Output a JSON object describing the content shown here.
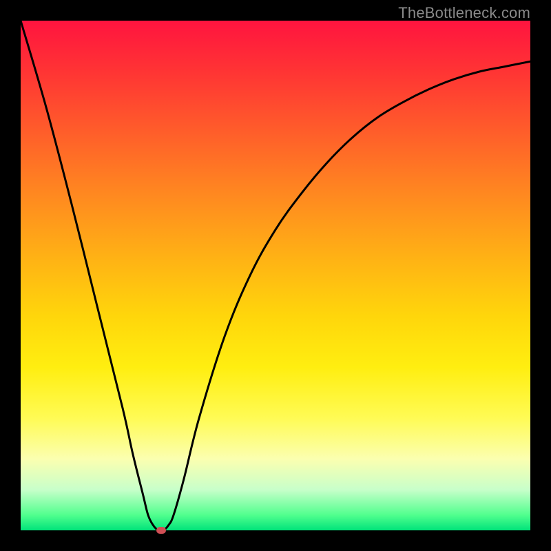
{
  "watermark": "TheBottleneck.com",
  "chart_data": {
    "type": "line",
    "title": "",
    "xlabel": "",
    "ylabel": "",
    "xlim": [
      0,
      100
    ],
    "ylim": [
      0,
      100
    ],
    "grid": false,
    "legend": false,
    "series": [
      {
        "name": "curve",
        "x": [
          0,
          5,
          10,
          15,
          20,
          22,
          24,
          25,
          26,
          27,
          28,
          29,
          30,
          32,
          35,
          40,
          45,
          50,
          55,
          60,
          65,
          70,
          75,
          80,
          85,
          90,
          95,
          100
        ],
        "values": [
          100,
          83,
          64,
          44,
          24,
          15,
          7,
          3,
          1,
          0,
          0,
          1,
          3,
          10,
          22,
          38,
          50,
          59,
          66,
          72,
          77,
          81,
          84,
          86.5,
          88.5,
          90,
          91,
          92
        ]
      }
    ],
    "marker": {
      "x": 27.5,
      "y": 0,
      "color": "#cf4f55"
    },
    "colors": {
      "frame": "#000000",
      "curve": "#000000",
      "gradient_top": "#ff143f",
      "gradient_bottom": "#00e37a"
    }
  }
}
